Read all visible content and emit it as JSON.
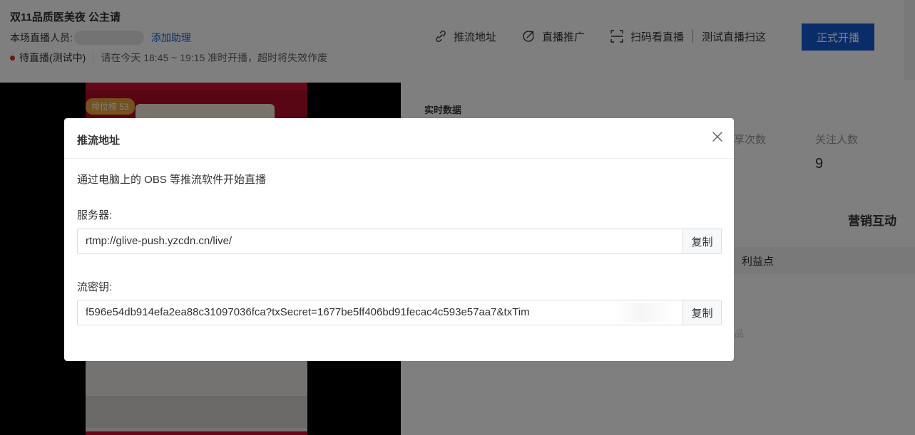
{
  "header": {
    "title": "双11品质医美夜 公主请",
    "staff_label": "本场直播人员:",
    "add_assistant": "添加助理",
    "status": "待直播(测试中)",
    "status_note": "请在今天 18:45 ~ 19:15 准时开播，超时将失效作废",
    "status_color": "#d42f15"
  },
  "actions": {
    "push_url": "推流地址",
    "promote": "直播推广",
    "scan": "扫码看直播",
    "test_scan": "测试直播扫这",
    "start": "正式开播",
    "accent": "#155bd4"
  },
  "video": {
    "rank_badge": "排位榜 53"
  },
  "stats": {
    "realtime_title": "实时数据",
    "share_label": "享次数",
    "follow_label": "关注人数",
    "follow_value": "9"
  },
  "marketing": {
    "title": "营销互动",
    "table_col": "利益点",
    "faint": "品"
  },
  "dialog": {
    "title": "推流地址",
    "description": "通过电脑上的 OBS 等推流软件开始直播",
    "server_label": "服务器:",
    "server_value": "rtmp://glive-push.yzcdn.cn/live/",
    "key_label": "流密钥:",
    "key_value": "f596e54db914efa2ea88c31097036fca?txSecret=1677be5ff406bd91fecac4c593e57aa7&txTim",
    "copy": "复制"
  }
}
